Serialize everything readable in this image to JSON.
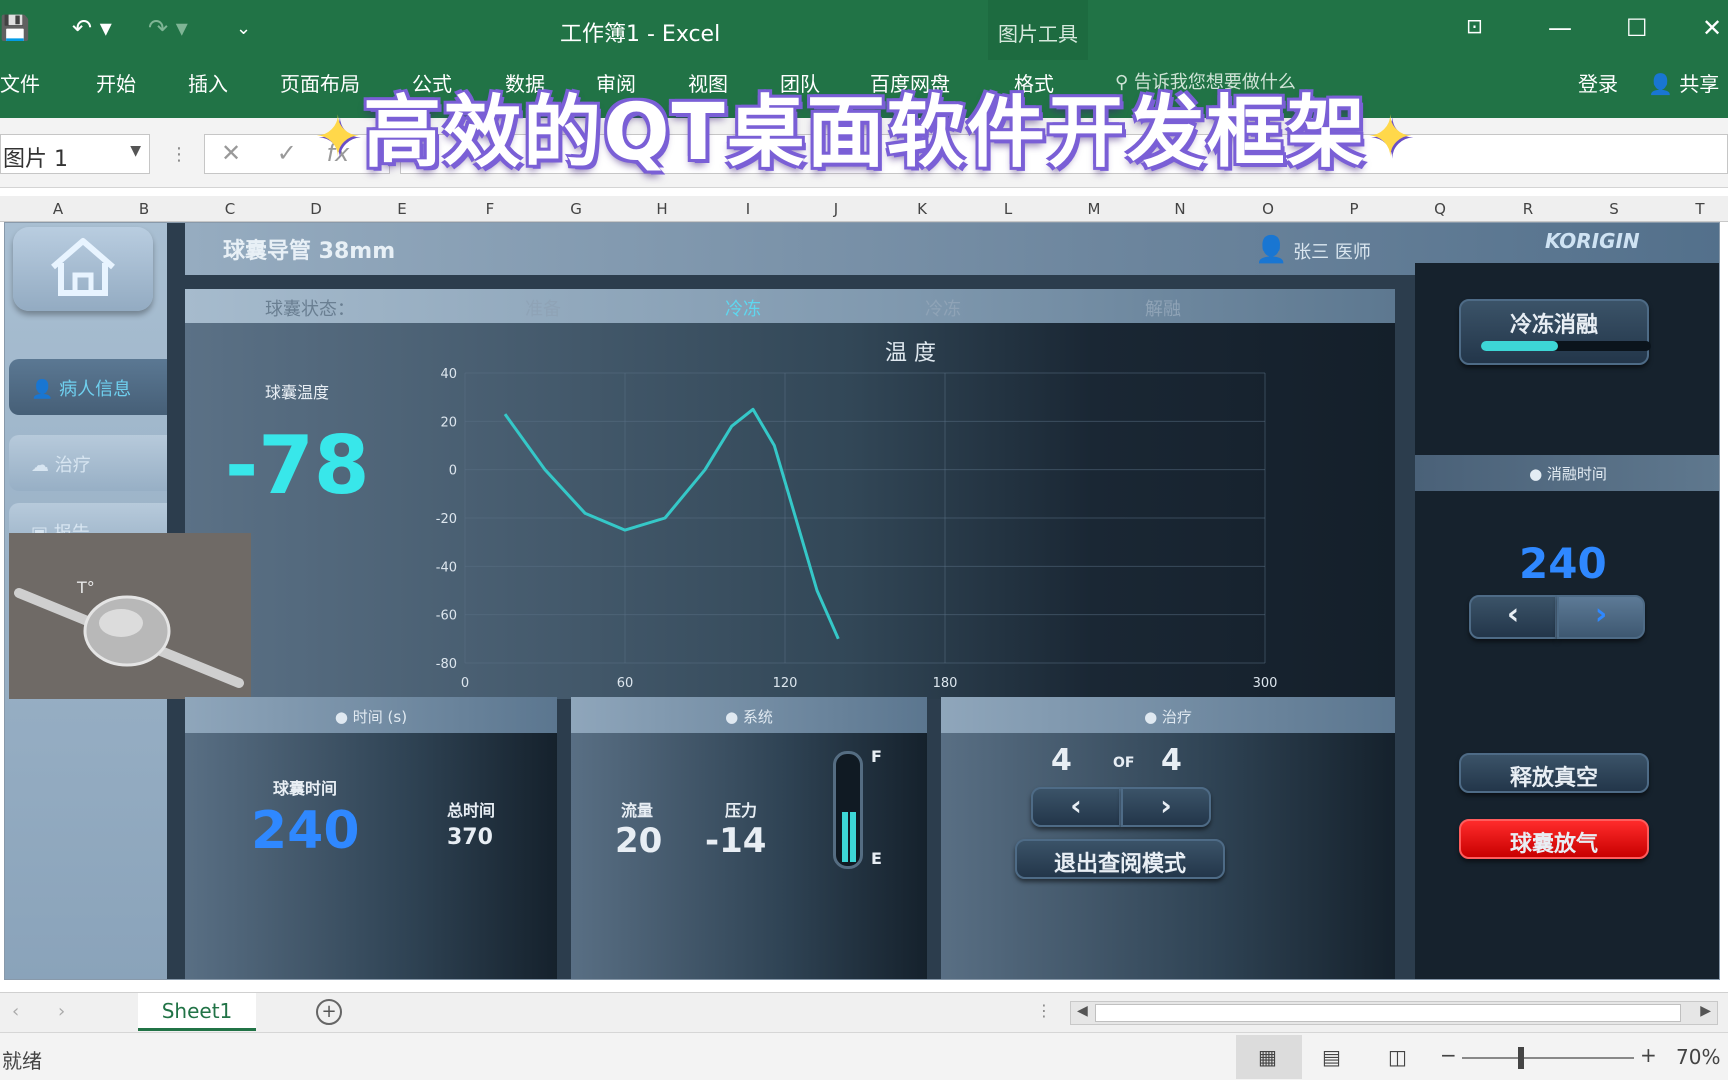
{
  "window": {
    "title": "工作簿1 - Excel",
    "picture_tools": "图片工具",
    "login": "登录",
    "share": "共享"
  },
  "ribbon": {
    "tabs": [
      "文件",
      "开始",
      "插入",
      "页面布局",
      "公式",
      "数据",
      "审阅",
      "视图",
      "团队",
      "百度网盘",
      "格式"
    ],
    "search_placeholder": "告诉我您想要做什么"
  },
  "banner": {
    "text": "高效的QT桌面软件开发框架"
  },
  "formula_bar": {
    "name_box": "图片 1",
    "cancel": "✕",
    "enter": "✓",
    "fx": "fx"
  },
  "columns": [
    "A",
    "B",
    "C",
    "D",
    "E",
    "F",
    "G",
    "H",
    "I",
    "J",
    "K",
    "L",
    "M",
    "N",
    "O",
    "P",
    "Q",
    "R",
    "S",
    "T"
  ],
  "app": {
    "patient_title": "球囊导管 38mm",
    "user": "张三 医师",
    "logo": "KORIGIN",
    "nav": {
      "patient_info": "病人信息",
      "treatment": "治疗",
      "report": "报告"
    },
    "status_row": {
      "label": "球囊状态：",
      "states": [
        "准备",
        "冷冻",
        "冷冻",
        "解融"
      ]
    },
    "balloon_temp_label": "球囊温度",
    "balloon_temp": "-78",
    "chart_title": "温 度",
    "right": {
      "freeze_thaw": "冷冻消融",
      "progress": 0.45,
      "thaw_time_header": "● 消融时间",
      "thaw_time_value": "240",
      "release_vacuum": "释放真空",
      "balloon_deflate": "球囊放气"
    },
    "time_panel": {
      "header": "● 时间 (s)",
      "balloon_time_label": "球囊时间",
      "balloon_time": "240",
      "total_label": "总时间",
      "total": "370"
    },
    "system_panel": {
      "header": "● 系统",
      "flow_label": "流量",
      "flow": "20",
      "pressure_label": "压力",
      "pressure": "-14",
      "gauge_top": "F",
      "gauge_bottom": "E"
    },
    "treat_panel": {
      "header": "● 治疗",
      "current": "4",
      "of": "OF",
      "total": "4",
      "exit_review": "退出查阅模式"
    }
  },
  "chart_data": {
    "type": "line",
    "title": "温 度",
    "x_ticks": [
      "0",
      "60",
      "120",
      "180",
      "300"
    ],
    "y_ticks": [
      "40",
      "20",
      "0",
      "-20",
      "-40",
      "-60",
      "-80"
    ],
    "ylim": [
      -80,
      40
    ],
    "series": [
      {
        "color": "#35c8c8",
        "x": [
          15,
          30,
          45,
          60,
          75,
          90,
          100,
          108,
          116,
          124,
          132,
          140
        ],
        "y": [
          23,
          0,
          -18,
          -25,
          -20,
          0,
          18,
          25,
          10,
          -20,
          -50,
          -70
        ]
      }
    ]
  },
  "sheet_tabs": {
    "active": "Sheet1",
    "add": "+"
  },
  "status_bar": {
    "ready": "就绪",
    "zoom": "70%"
  },
  "colors": {
    "excel_green": "#217346",
    "accent_cyan": "#38e7ea",
    "value_blue": "#2f88ff",
    "alert_red": "#e00000"
  }
}
